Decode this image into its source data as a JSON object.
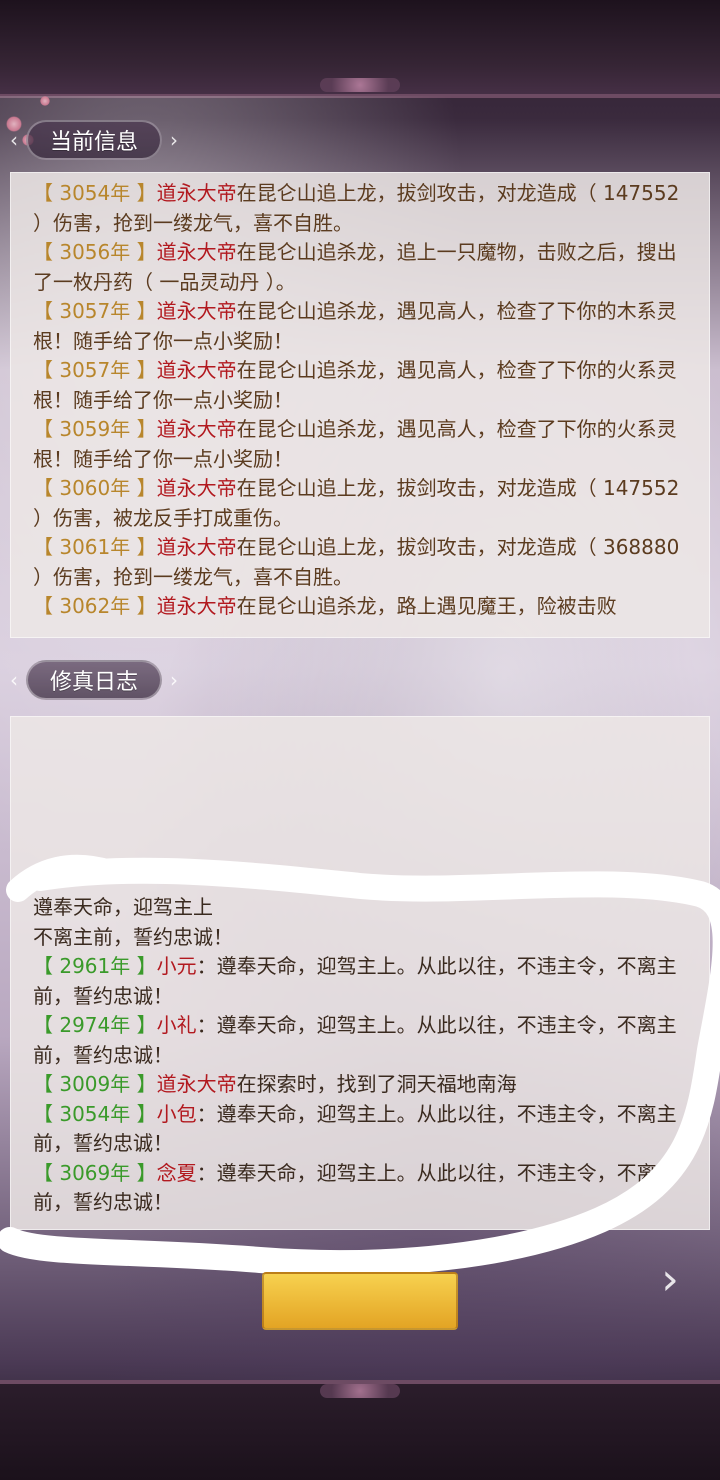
{
  "current_info": {
    "title": "当前信息",
    "entries": [
      {
        "year": "【 3054年 】",
        "name": "道永大帝",
        "text": "在昆仑山追上龙，拔剑攻击，对龙造成（ 147552 ）伤害，抢到一缕龙气，喜不自胜。"
      },
      {
        "year": "【 3056年 】",
        "name": "道永大帝",
        "text": "在昆仑山追杀龙，追上一只魔物，击败之后，搜出了一枚丹药（ 一品灵动丹 ）。"
      },
      {
        "year": "【 3057年 】",
        "name": "道永大帝",
        "text": "在昆仑山追杀龙，遇见高人，检查了下你的木系灵根！随手给了你一点小奖励！"
      },
      {
        "year": "【 3057年 】",
        "name": "道永大帝",
        "text": "在昆仑山追杀龙，遇见高人，检查了下你的火系灵根！随手给了你一点小奖励！"
      },
      {
        "year": "【 3059年 】",
        "name": "道永大帝",
        "text": "在昆仑山追杀龙，遇见高人，检查了下你的火系灵根！随手给了你一点小奖励！"
      },
      {
        "year": "【 3060年 】",
        "name": "道永大帝",
        "text": "在昆仑山追上龙，拔剑攻击，对龙造成（ 147552 ）伤害，被龙反手打成重伤。"
      },
      {
        "year": "【 3061年 】",
        "name": "道永大帝",
        "text": "在昆仑山追上龙，拔剑攻击，对龙造成（ 368880 ）伤害，抢到一缕龙气，喜不自胜。"
      },
      {
        "year": "【 3062年 】",
        "name": "道永大帝",
        "text": "在昆仑山追杀龙，路上遇见魔王，险被击败"
      }
    ]
  },
  "cultivation_log": {
    "title": "修真日志",
    "partial_line_1": "遵奉天命，迎驾主上",
    "partial_line_2": "不离主前，誓约忠诚！",
    "entries": [
      {
        "year": "【 2961年 】",
        "name": "小元",
        "text": "：遵奉天命，迎驾主上。从此以往，不违主令，不离主前，誓约忠诚！"
      },
      {
        "year": "【 2974年 】",
        "name": "小礼",
        "text": "：遵奉天命，迎驾主上。从此以往，不违主令，不离主前，誓约忠诚！"
      },
      {
        "year": "【 3009年 】",
        "name": "道永大帝",
        "text": "在探索时，找到了洞天福地南海"
      },
      {
        "year": "【 3054年 】",
        "name": "小包",
        "text": "：遵奉天命，迎驾主上。从此以往，不违主令，不离主前，誓约忠诚！"
      },
      {
        "year": "【 3069年 】",
        "name": "念夏",
        "text": "：遵奉天命，迎驾主上。从此以往，不违主令，不离主前，誓约忠诚！"
      }
    ]
  },
  "bottom": {
    "button_label": "",
    "next_arrow": "›"
  },
  "icons": {
    "left_chev": "‹",
    "right_chev": "›"
  },
  "colors": {
    "year_current": "#b8862c",
    "name": "#b2191f",
    "text_current": "#5b3b1f",
    "year_log": "#3a9a2a",
    "button_gold": "#e3a424"
  }
}
